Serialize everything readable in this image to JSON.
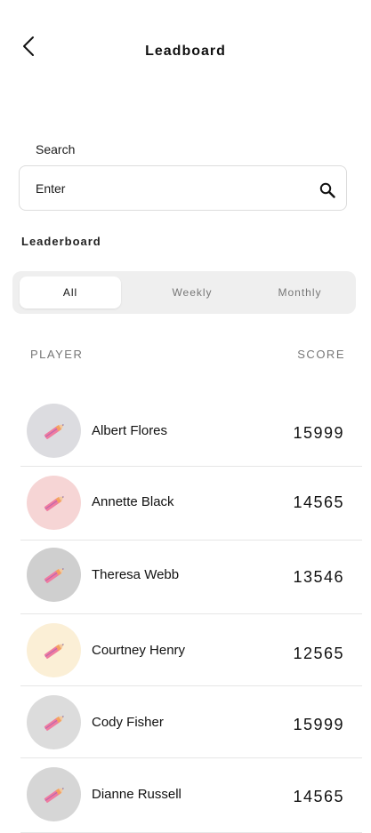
{
  "header": {
    "title": "Leadboard",
    "back_icon": "chevron-left-icon"
  },
  "search": {
    "label": "Search",
    "placeholder": "Enter",
    "icon": "search-icon"
  },
  "section": {
    "heading": "Leaderboard"
  },
  "tabs": [
    {
      "label": "All",
      "active": true
    },
    {
      "label": "Weekly",
      "active": false
    },
    {
      "label": "Monthly",
      "active": false
    }
  ],
  "columns": {
    "player": "PLAYER",
    "score": "SCORE"
  },
  "players": [
    {
      "name": "Albert Flores",
      "score": "15999",
      "avatar_bg": "#dcdce0"
    },
    {
      "name": "Annette Black",
      "score": "14565",
      "avatar_bg": "#f6d5d5"
    },
    {
      "name": "Theresa Webb",
      "score": "13546",
      "avatar_bg": "#cfcfcf"
    },
    {
      "name": "Courtney Henry",
      "score": "12565",
      "avatar_bg": "#fbefd6"
    },
    {
      "name": "Cody Fisher",
      "score": "15999",
      "avatar_bg": "#dcdcdc"
    },
    {
      "name": "Dianne Russell",
      "score": "14565",
      "avatar_bg": "#d6d6d6"
    }
  ]
}
